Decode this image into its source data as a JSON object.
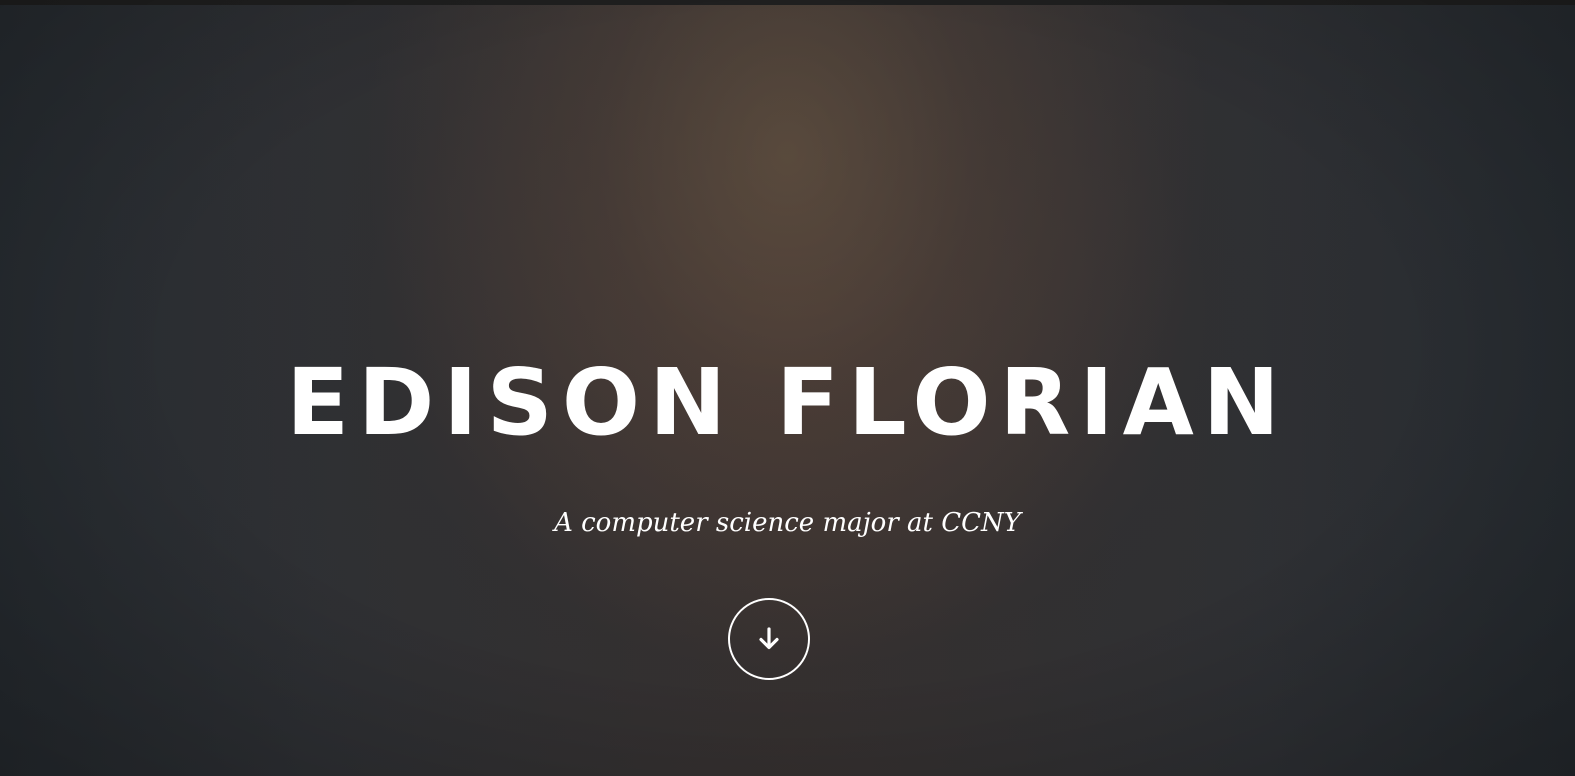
{
  "hero": {
    "title": "EDISON FLORIAN",
    "subtitle": "A computer science major at CCNY",
    "scroll_icon": "arrow-down-icon"
  },
  "colors": {
    "text": "#ffffff",
    "background_dark": "#2a2a2c",
    "glow_warm": "#705c46"
  }
}
